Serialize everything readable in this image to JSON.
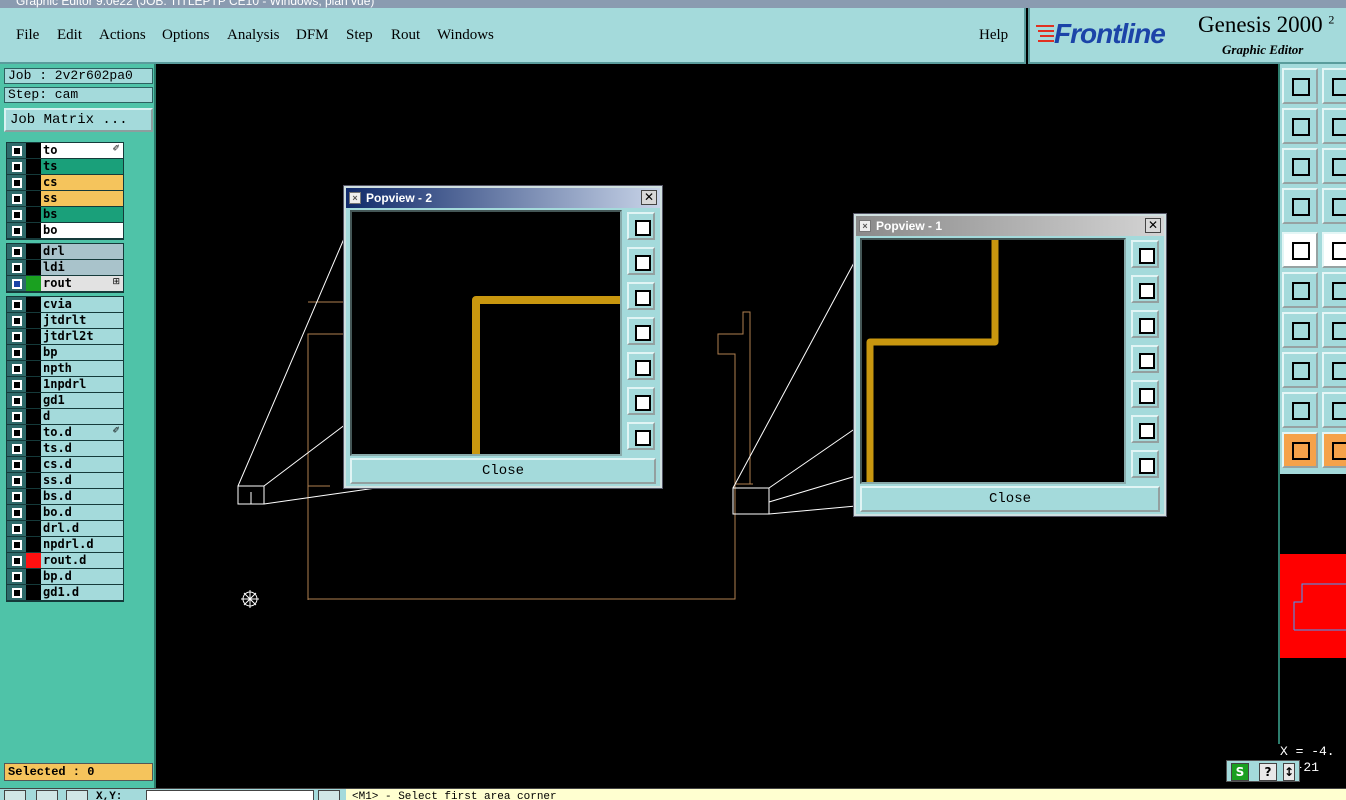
{
  "window": {
    "title": "Graphic Editor 9.0e22 (JOB: TITLEPTP CE10 - Windows, plan vue)"
  },
  "menu": {
    "items": [
      "File",
      "Edit",
      "Actions",
      "Options",
      "Analysis",
      "DFM",
      "Step",
      "Rout",
      "Windows"
    ],
    "help": "Help"
  },
  "logo": {
    "brand": "Frontline",
    "product": "Genesis 2000",
    "product_sup": "2",
    "subtitle": "Graphic Editor"
  },
  "job": {
    "job_label": "Job : 2v2r602pa0",
    "step_label": "Step: cam",
    "matrix_button": "Job Matrix ..."
  },
  "layers": {
    "group1": [
      {
        "name": "to",
        "color": "#ffffff",
        "swatch": "#000000",
        "marker": "✐"
      },
      {
        "name": "ts",
        "color": "#1aa07a",
        "swatch": "#000000"
      },
      {
        "name": "cs",
        "color": "#f5c45c",
        "swatch": "#000000"
      },
      {
        "name": "ss",
        "color": "#f5c45c",
        "swatch": "#000000"
      },
      {
        "name": "bs",
        "color": "#1aa07a",
        "swatch": "#000000"
      },
      {
        "name": "bo",
        "color": "#ffffff",
        "swatch": "#000000"
      }
    ],
    "group2": [
      {
        "name": "drl",
        "color": "#a9c3cb",
        "swatch": "#000000"
      },
      {
        "name": "ldi",
        "color": "#a9c3cb",
        "swatch": "#000000"
      },
      {
        "name": "rout",
        "color": "#e2e2e2",
        "swatch": "#1aa020",
        "marker": "⊞",
        "active": true
      }
    ],
    "group3": [
      {
        "name": "cvia",
        "color": "#a4dadb",
        "swatch": "#000000"
      },
      {
        "name": "jtdrlt",
        "color": "#a4dadb",
        "swatch": "#000000"
      },
      {
        "name": "jtdrl2t",
        "color": "#a4dadb",
        "swatch": "#000000"
      },
      {
        "name": "bp",
        "color": "#a4dadb",
        "swatch": "#000000"
      },
      {
        "name": "npth",
        "color": "#a4dadb",
        "swatch": "#000000"
      },
      {
        "name": "1npdrl",
        "color": "#a4dadb",
        "swatch": "#000000"
      },
      {
        "name": "gd1",
        "color": "#a4dadb",
        "swatch": "#000000"
      },
      {
        "name": "d",
        "color": "#a4dadb",
        "swatch": "#000000"
      },
      {
        "name": "to.d",
        "color": "#a4dadb",
        "swatch": "#000000",
        "marker": "✐"
      },
      {
        "name": "ts.d",
        "color": "#a4dadb",
        "swatch": "#000000"
      },
      {
        "name": "cs.d",
        "color": "#a4dadb",
        "swatch": "#000000"
      },
      {
        "name": "ss.d",
        "color": "#a4dadb",
        "swatch": "#000000"
      },
      {
        "name": "bs.d",
        "color": "#a4dadb",
        "swatch": "#000000"
      },
      {
        "name": "bo.d",
        "color": "#a4dadb",
        "swatch": "#000000"
      },
      {
        "name": "drl.d",
        "color": "#a4dadb",
        "swatch": "#000000"
      },
      {
        "name": "npdrl.d",
        "color": "#a4dadb",
        "swatch": "#000000"
      },
      {
        "name": "rout.d",
        "color": "#a4dadb",
        "swatch": "#ff1010"
      },
      {
        "name": "bp.d",
        "color": "#a4dadb",
        "swatch": "#000000"
      },
      {
        "name": "gd1.d",
        "color": "#a4dadb",
        "swatch": "#000000"
      }
    ]
  },
  "selected": "Selected : 0",
  "popview2": {
    "title": "Popview - 2",
    "close": "Close"
  },
  "popview1": {
    "title": "Popview - 1",
    "close": "Close"
  },
  "coords": {
    "x": "X = -4.",
    "y": "= -21"
  },
  "statusbar": {
    "xy_label": "X,Y:",
    "prompt": "<M1> - Select first area corner"
  },
  "colors": {
    "trace": "#c9970f",
    "outline": "#b08050",
    "panel": "#a4dadb",
    "accent": "#4fc3a8"
  }
}
